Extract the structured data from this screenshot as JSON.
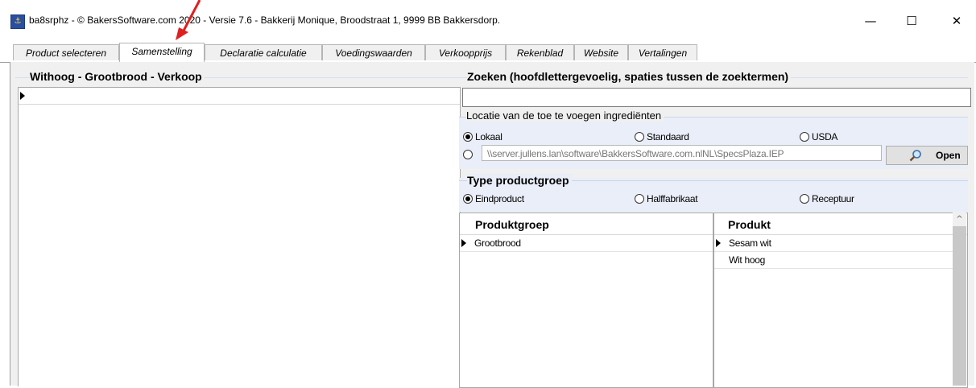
{
  "window": {
    "title": "ba8srphz - © BakersSoftware.com 2020 - Versie 7.6 - Bakkerij Monique, Broodstraat 1, 9999 BB Bakkersdorp.",
    "minimize": "—",
    "maximize": "☐",
    "close": "✕"
  },
  "tabs": [
    {
      "label": "Product selecteren"
    },
    {
      "label": "Samenstelling"
    },
    {
      "label": "Declaratie calculatie"
    },
    {
      "label": "Voedingswaarden"
    },
    {
      "label": "Verkoopprijs"
    },
    {
      "label": "Rekenblad"
    },
    {
      "label": "Website"
    },
    {
      "label": "Vertalingen"
    }
  ],
  "active_tab": "Samenstelling",
  "left_panel": {
    "title": "Withoog - Grootbrood - Verkoop"
  },
  "search": {
    "title": "Zoeken (hoofdlettergevoelig, spaties tussen de zoektermen)",
    "value": ""
  },
  "location": {
    "title": "Locatie van de toe te voegen ingrediënten",
    "options": [
      {
        "label": "Lokaal",
        "selected": true
      },
      {
        "label": "Standaard",
        "selected": false
      },
      {
        "label": "USDA",
        "selected": false
      }
    ],
    "path_value": "\\\\server.jullens.lan\\software\\BakkersSoftware.com.nlNL\\SpecsPlaza.IEP",
    "path_selected": false,
    "open_label": "Open"
  },
  "product_type": {
    "title": "Type productgroep",
    "options": [
      {
        "label": "Eindproduct",
        "selected": true
      },
      {
        "label": "Halffabrikaat",
        "selected": false
      },
      {
        "label": "Receptuur",
        "selected": false
      }
    ]
  },
  "group_table": {
    "header": "Produktgroep",
    "rows": [
      "Grootbrood"
    ]
  },
  "product_table": {
    "header": "Produkt",
    "rows": [
      "Sesam wit",
      "Wit hoog"
    ]
  },
  "colors": {
    "accent_arrow": "#e02020",
    "section_bg": "#f0f0f0",
    "group_line": "#d5dff0"
  },
  "icons": {
    "app": "bakery-app-icon",
    "open": "magnifier-icon",
    "row": "row-indicator-icon",
    "scroll": "chevron-up-icon"
  }
}
